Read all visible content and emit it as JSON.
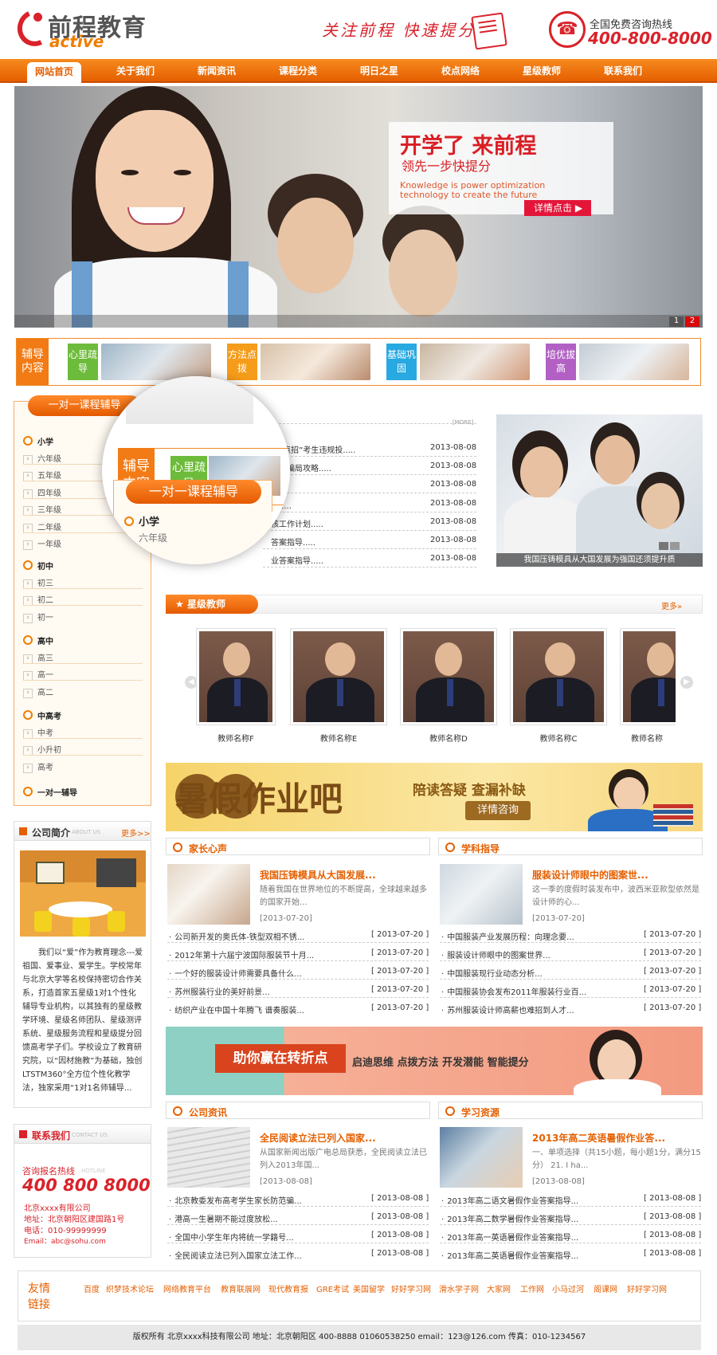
{
  "header": {
    "logo_cn": "前程教育",
    "logo_en": "active",
    "slogan": "关注前程 快速提分",
    "hotline_label": "全国免费咨询热线",
    "hotline_number": "400-800-8000",
    "colors": {
      "brand": "#d9222a",
      "accent": "#f07d00"
    }
  },
  "nav": [
    "网站首页",
    "关于我们",
    "新闻资讯",
    "课程分类",
    "明日之星",
    "校点网络",
    "星级教师",
    "联系我们"
  ],
  "banner": {
    "title": "开学了 来前程",
    "subtitle": "领先一步快提分",
    "english": "Knowledge is power optimization technology to create the future",
    "button": "详情点击",
    "pages": [
      "1",
      "2"
    ],
    "active_page": "2"
  },
  "strip": {
    "head": "辅导内容",
    "cells": [
      {
        "tag": "心里疏导",
        "color": "#6dbb3a"
      },
      {
        "tag": "方法点拨",
        "color": "#f59c1a"
      },
      {
        "tag": "基础巩固",
        "color": "#29a9e1"
      },
      {
        "tag": "培优拔高",
        "color": "#b260c4"
      }
    ]
  },
  "sidebar": {
    "head": "一对一课程辅导",
    "groups": [
      {
        "title": "小学",
        "items": [
          "六年级",
          "五年级",
          "四年级",
          "三年级",
          "二年级",
          "一年级"
        ]
      },
      {
        "title": "初中",
        "items": [
          "初三",
          "初二",
          "初一"
        ]
      },
      {
        "title": "高中",
        "items": [
          "高三",
          "高一",
          "高二"
        ]
      },
      {
        "title": "中高考",
        "items": [
          "中考",
          "小升初",
          "高考"
        ]
      },
      {
        "title": "一对一辅导",
        "items": []
      }
    ]
  },
  "magnifier": {
    "strip_head": "辅导内容",
    "strip_tag": "心里疏导",
    "side_head": "一对一课程辅导",
    "group": "小学",
    "item": "六年级"
  },
  "news": {
    "more": "[MORE]",
    "items": [
      {
        "title": "对“点招”考生违规投.....",
        "date": "2013-08-08"
      },
      {
        "title": "防范骗局攻略.....",
        "date": "2013-08-08"
      },
      {
        "title": "",
        "date": "2013-08-08"
      },
      {
        "title": "导.....",
        "date": "2013-08-08"
      },
      {
        "title": "核工作计划.....",
        "date": "2013-08-08"
      },
      {
        "title": "答案指导.....",
        "date": "2013-08-08"
      },
      {
        "title": "业答案指导.....",
        "date": "2013-08-08"
      }
    ]
  },
  "right_photo": {
    "caption": "我国压铸模具从大国发展为强国还须提升质"
  },
  "teachers": {
    "title": "星级教师",
    "more": "更多»",
    "list": [
      "教师名称F",
      "教师名称E",
      "教师名称D",
      "教师名称C",
      "教师名称"
    ]
  },
  "ad1": {
    "big": "暑假作业吧",
    "sub": "陪读答疑 查漏补缺",
    "button": "详情咨询"
  },
  "parents": {
    "title": "家长心声",
    "feature": {
      "title": "我国压铸模具从大国发展...",
      "text": "随着我国在世界地位的不断提高，全球越来越多的国家开始...",
      "date": "[2013-07-20]"
    },
    "items": [
      {
        "t": "公司新开发的奥氏体-铁型双相不锈...",
        "d": "[ 2013-07-20 ]"
      },
      {
        "t": "2012年第十六届宁波国际服装节十月...",
        "d": "[ 2013-07-20 ]"
      },
      {
        "t": "一个好的服装设计师需要具备什么...",
        "d": "[ 2013-07-20 ]"
      },
      {
        "t": "苏州服装行业的美好前景...",
        "d": "[ 2013-07-20 ]"
      },
      {
        "t": "纺织产业在中国十年腾飞 谱奏服装...",
        "d": "[ 2013-07-20 ]"
      }
    ]
  },
  "subjects": {
    "title": "学科指导",
    "feature": {
      "title": "服装设计师眼中的图案世...",
      "text": "这一季的度假时装发布中，波西米亚款型依然是设计师的心...",
      "date": "[2013-07-20]"
    },
    "items": [
      {
        "t": "中国服装产业发展历程：向理念要...",
        "d": "[ 2013-07-20 ]"
      },
      {
        "t": "服装设计师眼中的图案世界...",
        "d": "[ 2013-07-20 ]"
      },
      {
        "t": "中国服装现行业动态分析...",
        "d": "[ 2013-07-20 ]"
      },
      {
        "t": "中国服装协会发布2011年服装行业百...",
        "d": "[ 2013-07-20 ]"
      },
      {
        "t": "苏州服装设计师高薪也难招到人才...",
        "d": "[ 2013-07-20 ]"
      }
    ]
  },
  "ad2": {
    "tag": "助你赢在转折点",
    "sub": "启迪思维  点拨方法  开发潜能  智能提分"
  },
  "company": {
    "title": "公司资讯",
    "feature": {
      "title": "全民阅读立法已列入国家...",
      "text": "从国家新闻出版广电总局获悉，全民阅读立法已列入2013年国...",
      "date": "[2013-08-08]"
    },
    "items": [
      {
        "t": "北京教委发布高考学生家长防范骗...",
        "d": "[ 2013-08-08 ]"
      },
      {
        "t": "港高一生暑期不能过度放松...",
        "d": "[ 2013-08-08 ]"
      },
      {
        "t": "全国中小学生年内将统一学籍号...",
        "d": "[ 2013-08-08 ]"
      },
      {
        "t": "全民阅读立法已列入国家立法工作...",
        "d": "[ 2013-08-08 ]"
      }
    ]
  },
  "resources": {
    "title": "学习资源",
    "feature": {
      "title": "2013年高二英语暑假作业答...",
      "text": "一、单项选择（共15小题，每小题1分，满分15分） 21. I ha...",
      "date": "[2013-08-08]"
    },
    "items": [
      {
        "t": "2013年高二语文暑假作业答案指导...",
        "d": "[ 2013-08-08 ]"
      },
      {
        "t": "2013年高二数学暑假作业答案指导...",
        "d": "[ 2013-08-08 ]"
      },
      {
        "t": "2013年高一英语暑假作业答案指导...",
        "d": "[ 2013-08-08 ]"
      },
      {
        "t": "2013年高二英语暑假作业答案指导...",
        "d": "[ 2013-08-08 ]"
      }
    ]
  },
  "intro": {
    "title": "公司简介",
    "ghost": "ABOUT US",
    "more": "更多>>",
    "text": "我们以“爱”作为教育理念---爱祖国、爱事业、爱学生。学校常年与北京大学等名校保持密切合作关系，打造首家五星级1对1个性化辅导专业机构，以其独有的星级教学环境、星级名师团队、星级测评系统、星级服务流程和星级提分回馈高考学子们。学校设立了教育研究院，以“因材施教”为基础，独创LTSTM360°全方位个性化教学法，独家采用“1对1名师辅导..."
  },
  "contact": {
    "title": "联系我们",
    "ghost": "CONTACT US",
    "hotline_label": "咨询报名热线",
    "hotline_ghost": "HOTLINE",
    "number": "400 800 8000",
    "lines": [
      "北京xxxx有限公司",
      "地址：北京朝阳区建国路1号",
      "电话：010-99999999",
      "Email：abc@sohu.com"
    ]
  },
  "links": {
    "head": "友情链接",
    "list": [
      "百度",
      "织梦技术论坛",
      "网络教育平台",
      "教育联展网",
      "现代教育报",
      "GRE考试",
      "美国留学",
      "好好学习网",
      "滑水学子网",
      "大家网",
      "工作网",
      "小马过河",
      "阁课网",
      "好好学习网"
    ]
  },
  "footer": "版权所有 北京xxxx科技有限公司 地址：北京朝阳区 400-8888 01060538250 email：123@126.com 传真：010-1234567"
}
